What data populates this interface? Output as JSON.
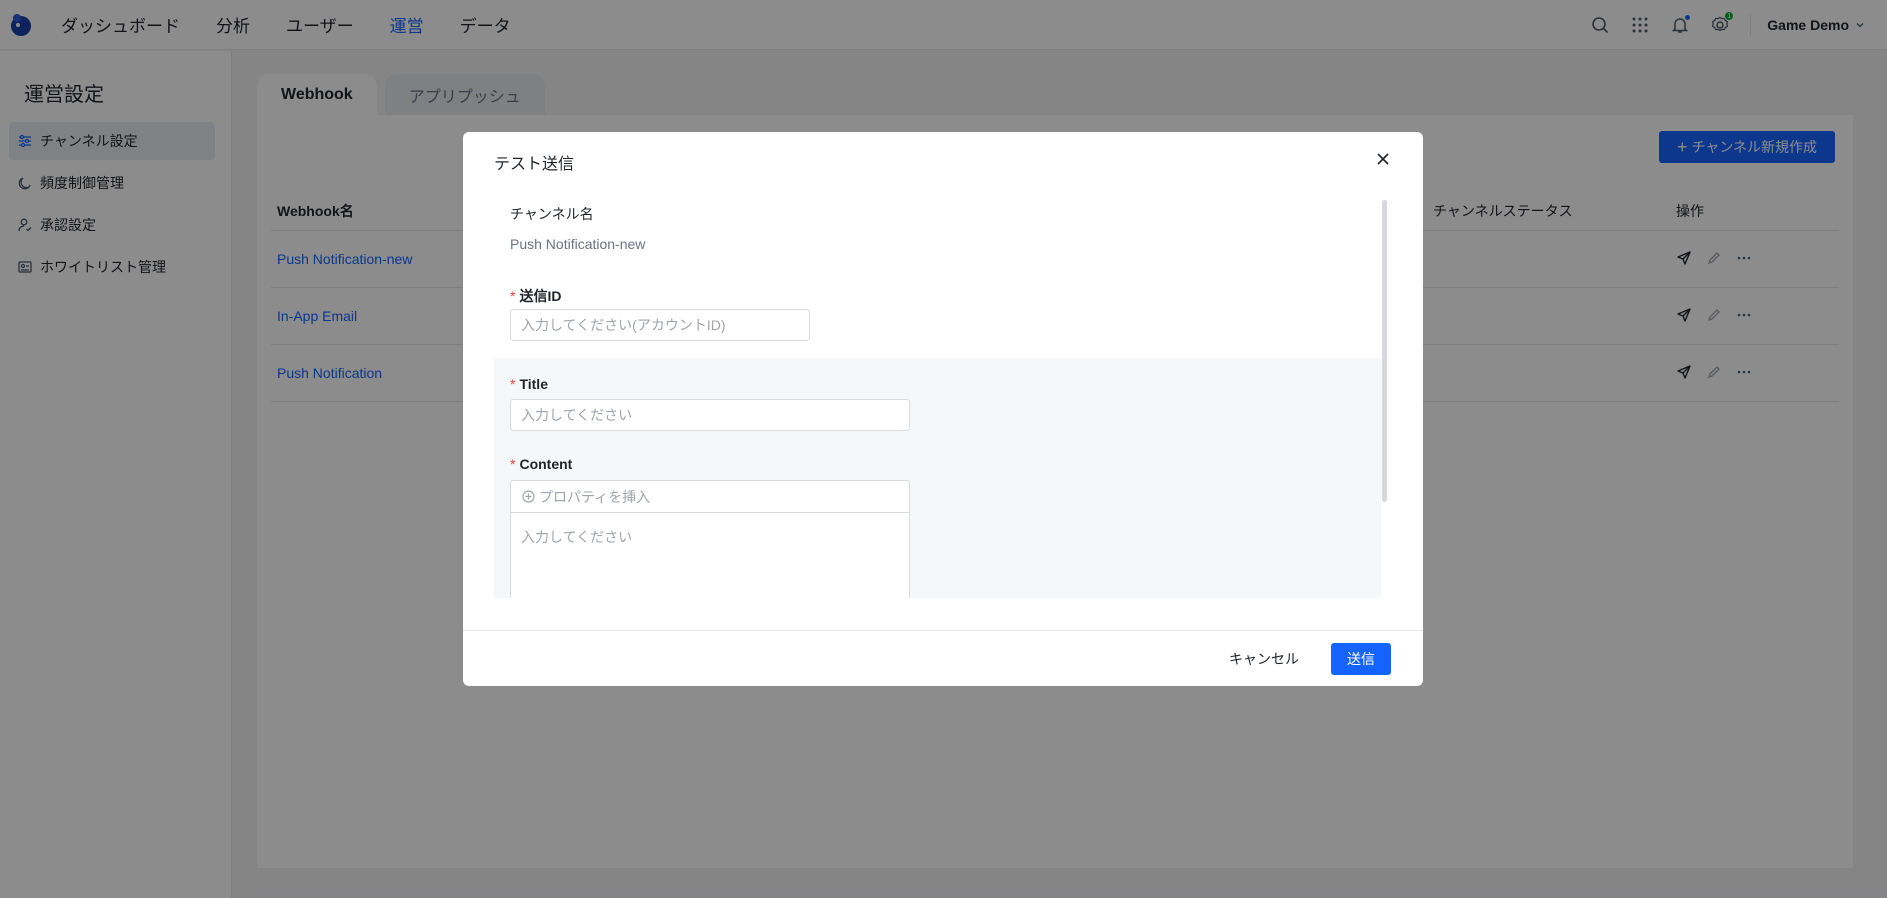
{
  "app": {
    "nav": [
      {
        "label": "ダッシュボード"
      },
      {
        "label": "分析"
      },
      {
        "label": "ユーザー"
      },
      {
        "label": "運営",
        "active": true
      },
      {
        "label": "データ"
      }
    ],
    "badge_count": "1",
    "project_name": "Game Demo",
    "accent_color": "#1664ff"
  },
  "sidebar": {
    "title": "運営設定",
    "items": [
      {
        "label": "チャンネル設定",
        "icon": "sliders-icon",
        "active": true
      },
      {
        "label": "頻度制御管理",
        "icon": "moon-icon"
      },
      {
        "label": "承認設定",
        "icon": "user-check-icon"
      },
      {
        "label": "ホワイトリスト管理",
        "icon": "id-card-icon"
      }
    ]
  },
  "tabs": [
    {
      "label": "Webhook",
      "active": true
    },
    {
      "label": "アプリプッシュ"
    }
  ],
  "main": {
    "create_button": "チャンネル新規作成",
    "table": {
      "columns": {
        "name": "Webhook名",
        "status": "チャンネルステータス",
        "ops": "操作"
      },
      "rows": [
        {
          "name": "Push Notification-new",
          "enabled": true
        },
        {
          "name": "In-App Email",
          "enabled": true
        },
        {
          "name": "Push Notification",
          "enabled": true
        }
      ]
    }
  },
  "modal": {
    "title": "テスト送信",
    "channel_label": "チャンネル名",
    "channel_value": "Push Notification-new",
    "send_id_label": "送信ID",
    "send_id_placeholder": "入力してください(アカウントID)",
    "title_label": "Title",
    "title_placeholder": "入力してください",
    "content_label": "Content",
    "insert_property": "プロパティを挿入",
    "content_placeholder": "入力してください",
    "cancel": "キャンセル",
    "send": "送信"
  }
}
